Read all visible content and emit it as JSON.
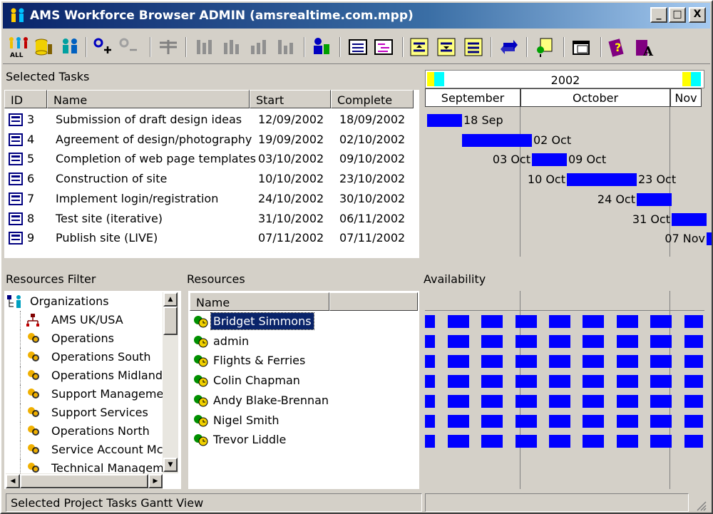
{
  "window": {
    "title": "AMS Workforce Browser ADMIN (amsrealtime.com.mpp)"
  },
  "window_buttons": {
    "minimize": "_",
    "maximize": "□",
    "close": "X"
  },
  "toolbar": {
    "buttons": [
      "all-resources-icon",
      "database-icon",
      "people-icon",
      "add-task-icon",
      "remove-task-icon",
      "split-icon",
      "bars1-icon",
      "bars2-icon",
      "bars3-icon",
      "bars4-icon",
      "resource-assign-icon",
      "list-view-icon",
      "gantt-view-icon",
      "expand-icon",
      "collapse-icon",
      "level-icon",
      "refresh-icon",
      "export-icon",
      "window-icon",
      "help-icon",
      "about-icon"
    ]
  },
  "tasks": {
    "label": "Selected Tasks",
    "columns": [
      "ID",
      "Name",
      "Start",
      "Complete"
    ],
    "rows": [
      {
        "id": "3",
        "name": "Submission of draft design ideas",
        "start": "12/09/2002",
        "complete": "18/09/2002"
      },
      {
        "id": "4",
        "name": "Agreement of design/photography",
        "start": "19/09/2002",
        "complete": "02/10/2002"
      },
      {
        "id": "5",
        "name": "Completion of web page templates",
        "start": "03/10/2002",
        "complete": "09/10/2002"
      },
      {
        "id": "6",
        "name": "Construction of site",
        "start": "10/10/2002",
        "complete": "23/10/2002"
      },
      {
        "id": "7",
        "name": "Implement login/registration",
        "start": "24/10/2002",
        "complete": "30/10/2002"
      },
      {
        "id": "8",
        "name": "Test site (iterative)",
        "start": "31/10/2002",
        "complete": "06/11/2002"
      },
      {
        "id": "9",
        "name": "Publish site (LIVE)",
        "start": "07/11/2002",
        "complete": "07/11/2002"
      }
    ]
  },
  "gantt": {
    "year": "2002",
    "months": [
      "September",
      "October",
      "Nov"
    ],
    "labels": [
      {
        "left": "",
        "right": "18 Sep"
      },
      {
        "left": "",
        "right": "02 Oct"
      },
      {
        "left": "03 Oct",
        "right": "09 Oct"
      },
      {
        "left": "10 Oct",
        "right": "23 Oct"
      },
      {
        "left": "24 Oct",
        "right": ""
      },
      {
        "left": "31 Oct",
        "right": ""
      },
      {
        "left": "07 Nov",
        "right": ""
      }
    ]
  },
  "filter": {
    "label": "Resources Filter",
    "root": "Organizations",
    "items": [
      "AMS UK/USA",
      "Operations",
      "Operations South",
      "Operations Midland",
      "Support Managemer",
      "Support Services",
      "Operations North",
      "Service Account Mc",
      "Technical Managem"
    ]
  },
  "resources": {
    "label": "Resources",
    "column": "Name",
    "items": [
      "Bridget Simmons",
      "admin",
      "Flights & Ferries",
      "Colin Chapman",
      "Andy Blake-Brennan",
      "Nigel Smith",
      "Trevor Liddle"
    ],
    "selected": "Bridget Simmons"
  },
  "availability": {
    "label": "Availability"
  },
  "status": {
    "text": "Selected Project Tasks Gantt View"
  },
  "colors": {
    "bar": "#0000ff",
    "title_start": "#0a246a",
    "selection": "#0a246a",
    "face": "#d4d0c8"
  }
}
